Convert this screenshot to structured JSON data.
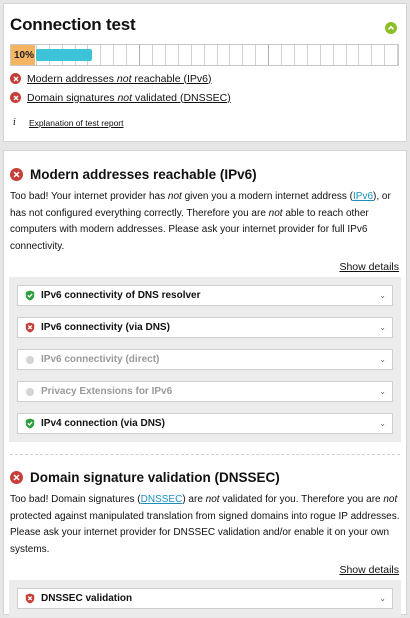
{
  "summary": {
    "title": "Connection test",
    "progress_label": "10%",
    "progress_value": 0.1,
    "issues": [
      {
        "before": "Modern addresses ",
        "em": "not",
        "after": " reachable (IPv6)"
      },
      {
        "before": "Domain signatures ",
        "em": "not",
        "after": " validated (DNSSEC)"
      }
    ],
    "explanation_link": "Explanation of test report"
  },
  "ipv6": {
    "title": "Modern addresses reachable (IPv6)",
    "desc_1": "Too bad! Your internet provider has ",
    "desc_em1": "not",
    "desc_2": " given you a modern internet address (",
    "desc_link": "IPv6",
    "desc_3": "), or has not configured everything correctly. Therefore you are ",
    "desc_em2": "not",
    "desc_4": " able to reach other computers with modern addresses. Please ask your internet provider for full IPv6 connectivity.",
    "show_details": "Show details",
    "checks": [
      {
        "label": "IPv6 connectivity of DNS resolver",
        "status": "ok"
      },
      {
        "label": "IPv6 connectivity (via DNS)",
        "status": "bad"
      },
      {
        "label": "IPv6 connectivity (direct)",
        "status": "skip"
      },
      {
        "label": "Privacy Extensions for IPv6",
        "status": "skip"
      },
      {
        "label": "IPv4 connection (via DNS)",
        "status": "ok"
      }
    ]
  },
  "dnssec": {
    "title": "Domain signature validation (DNSSEC)",
    "desc_1": "Too bad! Domain signatures (",
    "desc_link": "DNSSEC",
    "desc_2": ") are ",
    "desc_em1": "not",
    "desc_3": " validated for you. Therefore you are ",
    "desc_em2": "not",
    "desc_4": " protected against manipulated translation from signed domains into rogue IP addresses. Please ask your internet provider for DNSSEC validation and/or enable it on your own systems.",
    "show_details": "Show details",
    "checks": [
      {
        "label": "DNSSEC validation",
        "status": "bad"
      }
    ]
  },
  "colors": {
    "error": "#c53f38",
    "ok": "#2e9e3f",
    "progress_label_bg": "#f5b461",
    "progress_bar": "#3cc3d8",
    "link": "#1a8fbf"
  }
}
